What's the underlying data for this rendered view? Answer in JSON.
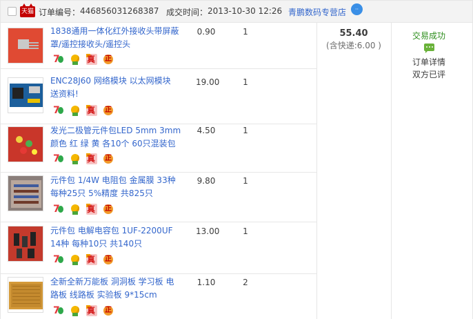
{
  "header": {
    "tmall_logo": "天猫",
    "order_no_label": "订单编号：",
    "order_no": "446856031268387",
    "deal_time_label": "成交时间：",
    "deal_time": "2013-10-30 12:26",
    "shop_name": "青鹏数码专营店",
    "chat_icon": "wangwang-chat-icon"
  },
  "items": [
    {
      "title": "1838通用一体化红外接收头带屏蔽罩/遥控接收头/遥控头",
      "price": "0.90",
      "qty": "1"
    },
    {
      "title": "ENC28J60 网络模块 以太网模块 送资料!",
      "price": "19.00",
      "qty": "1"
    },
    {
      "title": "发光二极管元件包LED 5mm 3mm 颜色 红 绿 黄 各10个 60只混装包",
      "price": "4.50",
      "qty": "1"
    },
    {
      "title": "元件包 1/4W 电阻包 金属膜 33种 每种25只 5%精度 共825只",
      "price": "9.80",
      "qty": "1"
    },
    {
      "title": "元件包 电解电容包 1UF-2200UF 14种 每种10只 共140只",
      "price": "13.00",
      "qty": "1"
    },
    {
      "title": "全新全新万能板 洞洞板 学习板 电路板 线路板 实验板 9*15cm",
      "price": "1.10",
      "qty": "2"
    }
  ],
  "badges": {
    "seven": "7",
    "zhen": "真",
    "zheng": "正"
  },
  "summary": {
    "total": "55.40",
    "shipping": "(含快递:6.00 )"
  },
  "status": {
    "success": "交易成功",
    "detail": "订单详情",
    "reviewed": "双方已评"
  },
  "colors": {
    "link": "#3366cc",
    "success": "#2f8f1f",
    "header_bg": "#f3f3f3",
    "border": "#e6e6e6"
  }
}
